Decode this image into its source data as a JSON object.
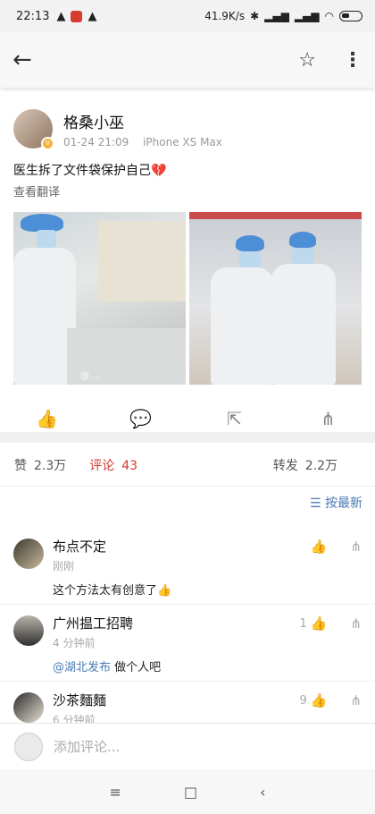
{
  "status_bar": {
    "time": "22:13",
    "network_speed": "41.9K/s",
    "icons": [
      "warning-icon",
      "app-badge-icon",
      "warning-icon",
      "bluetooth-icon",
      "signal-icon",
      "hd-signal-icon",
      "wifi-icon",
      "battery-icon"
    ]
  },
  "app_bar": {
    "back_icon": "arrow-left-icon",
    "star_icon": "star-outline-icon",
    "more_icon": "vertical-dots-icon"
  },
  "post": {
    "author": "格桑小巫",
    "time": "01-24 21:09",
    "device": "iPhone XS Max",
    "text": "医生拆了文件袋保护自己",
    "text_emoji": "💔",
    "translate_label": "查看翻译",
    "watermark": "@ ..."
  },
  "stats": {
    "likes_label": "赞",
    "likes_count": "2.3万",
    "comments_label": "评论",
    "comments_count": "43",
    "reposts_label": "转发",
    "reposts_count": "2.2万"
  },
  "sort": {
    "label": "按最新"
  },
  "comments": [
    {
      "name": "布点不定",
      "time": "刚刚",
      "text": "这个方法太有创意了",
      "emoji": "👍",
      "likes": ""
    },
    {
      "name": "广州揾工招聘",
      "time": "4 分钟前",
      "mention": "@湖北发布",
      "text": " 做个人吧",
      "likes": "1"
    },
    {
      "name": "沙茶麵麵",
      "time": "6 分钟前",
      "text": "",
      "likes": "9"
    }
  ],
  "composer": {
    "placeholder": "添加评论..."
  },
  "colors": {
    "accent_red": "#d23b33",
    "link_blue": "#4a7ab5"
  }
}
